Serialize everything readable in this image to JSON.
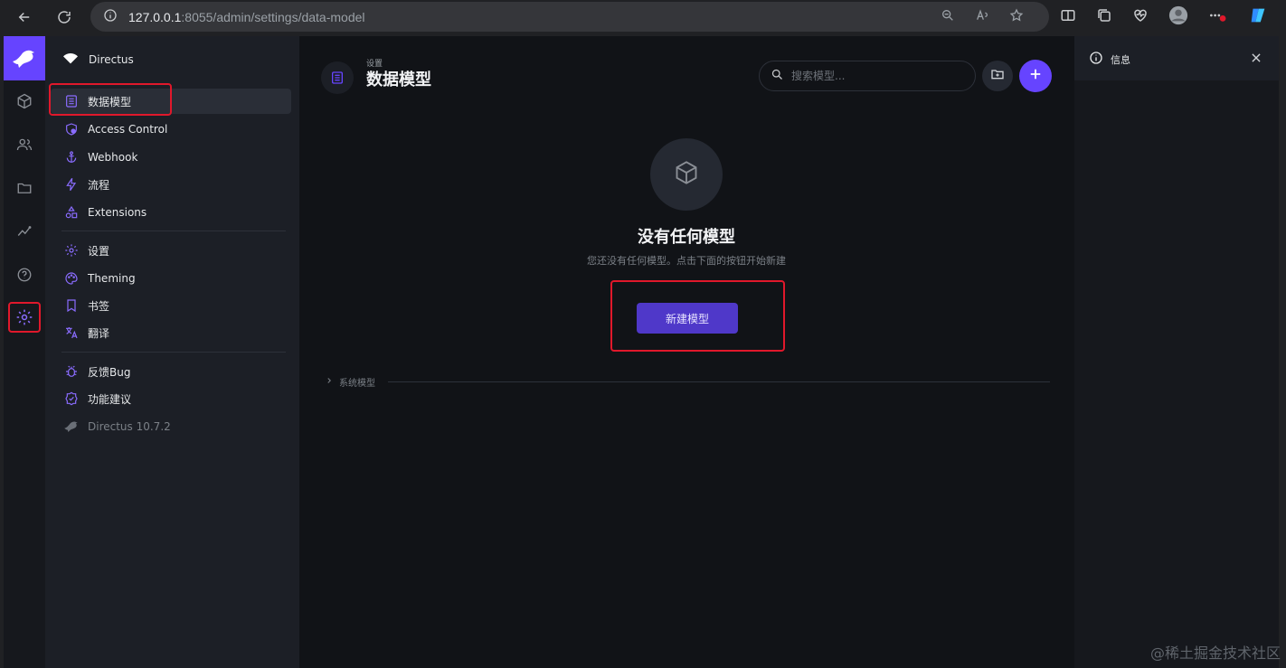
{
  "browser": {
    "url_host": "127.0.0.1",
    "url_rest": ":8055/admin/settings/data-model"
  },
  "project": {
    "name": "Directus"
  },
  "nav": {
    "group1": [
      {
        "label": "数据模型",
        "icon": "data-model-icon"
      },
      {
        "label": "Access Control",
        "icon": "shield-icon"
      },
      {
        "label": "Webhook",
        "icon": "anchor-icon"
      },
      {
        "label": "流程",
        "icon": "bolt-icon"
      },
      {
        "label": "Extensions",
        "icon": "shapes-icon"
      }
    ],
    "group2": [
      {
        "label": "设置",
        "icon": "gear-icon"
      },
      {
        "label": "Theming",
        "icon": "palette-icon"
      },
      {
        "label": "书签",
        "icon": "bookmark-icon"
      },
      {
        "label": "翻译",
        "icon": "translate-icon"
      }
    ],
    "group3": [
      {
        "label": "反馈Bug",
        "icon": "bug-icon"
      },
      {
        "label": "功能建议",
        "icon": "verified-icon"
      }
    ],
    "version": "Directus 10.7.2"
  },
  "header": {
    "breadcrumb": "设置",
    "title": "数据模型",
    "search_placeholder": "搜索模型..."
  },
  "empty_state": {
    "title": "没有任何模型",
    "description": "您还没有任何模型。点击下面的按钮开始新建",
    "button": "新建模型"
  },
  "system_section": {
    "label": "系统模型"
  },
  "sidebar": {
    "title": "信息"
  },
  "watermark": "@稀土掘金技术社区",
  "colors": {
    "accent": "#6644ff",
    "highlight": "#e0182b"
  }
}
